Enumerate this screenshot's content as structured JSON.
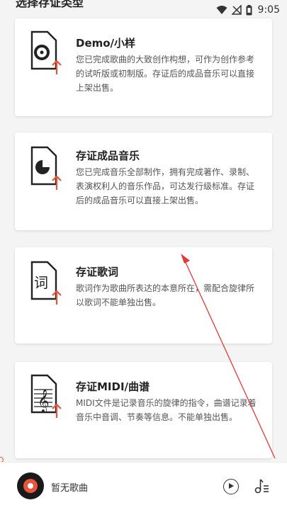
{
  "status_bar": {
    "time": "9:05"
  },
  "page": {
    "title": "选择存证类型"
  },
  "cards": [
    {
      "title": "Demo/小样",
      "desc": "您已完成歌曲的大致创作构想，可作为创作参考的试听版或初制版。存证后的成品音乐可以直接上架出售。",
      "icon": "disc-upload-icon"
    },
    {
      "title": "存证成品音乐",
      "desc": "您已完成音乐全部制作，拥有完成著作、录制、表演权利人的音乐作品，可达发行级标准。存证后的成品音乐可以直接上架出售。",
      "icon": "pie-upload-icon"
    },
    {
      "title": "存证歌词",
      "desc": "歌词作为歌曲所表达的本意所在，需配合旋律所以歌词不能单独出售。",
      "icon": "lyrics-upload-icon"
    },
    {
      "title": "存证MIDI/曲谱",
      "desc": "MIDI文件是记录音乐的旋律的指令，曲谱记录着音乐中音调、节奏等信息。不能单独出售。",
      "icon": "sheet-music-upload-icon"
    }
  ],
  "player": {
    "song": "暂无歌曲"
  },
  "colors": {
    "accent": "#e9553a",
    "text": "#222222",
    "muted": "#555555",
    "background": "#f4f4f4"
  }
}
